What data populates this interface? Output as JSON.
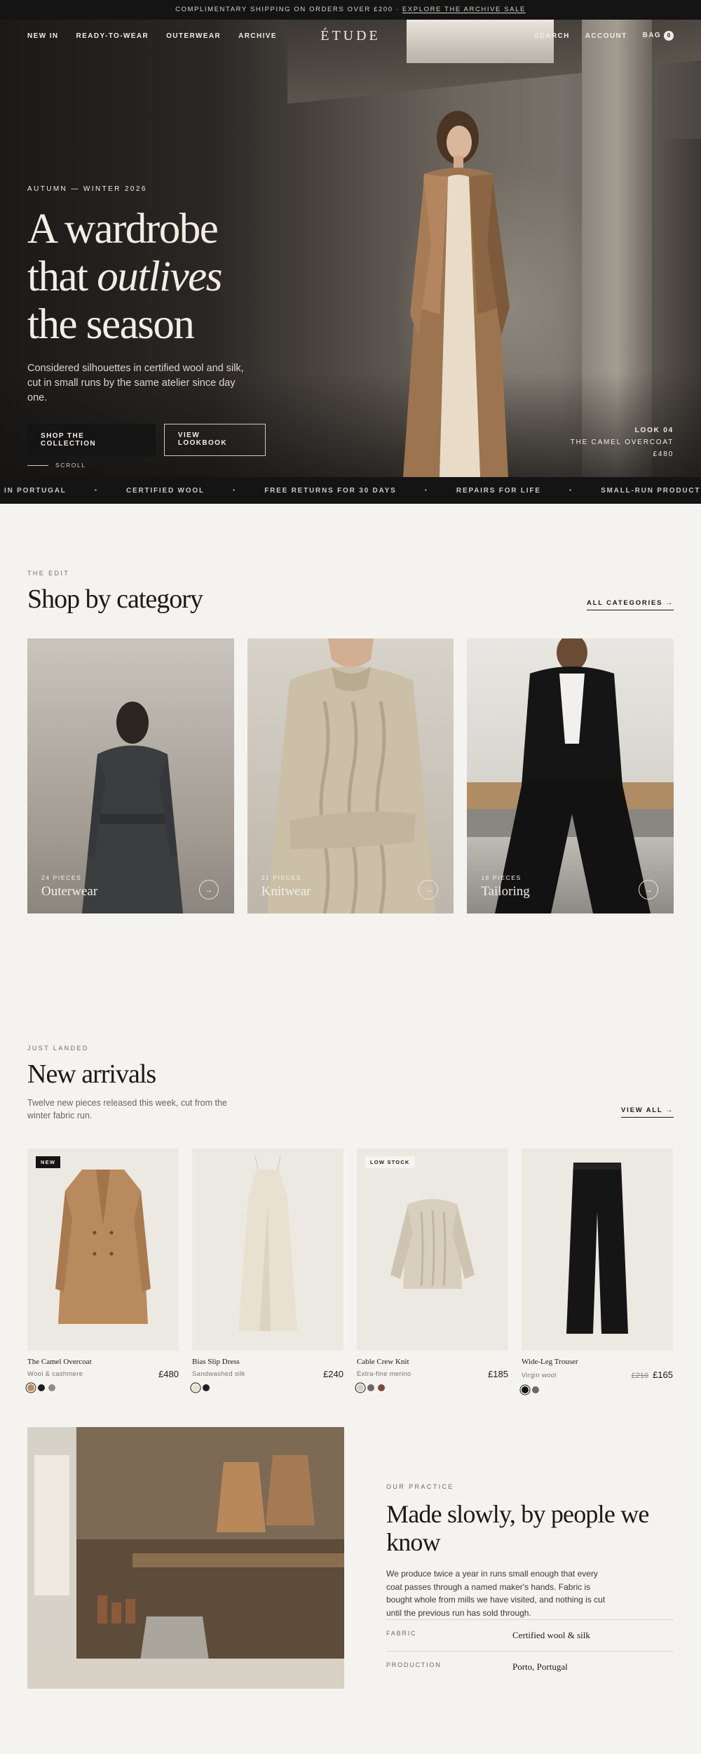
{
  "topbar": {
    "text": "COMPLIMENTARY SHIPPING ON ORDERS OVER £200 · ",
    "link": "EXPLORE THE ARCHIVE SALE"
  },
  "nav": {
    "left": [
      "NEW IN",
      "READY-TO-WEAR",
      "OUTERWEAR",
      "ARCHIVE"
    ],
    "logo": "ÉTUDE",
    "search": "SEARCH",
    "account": "ACCOUNT",
    "bag": "BAG",
    "bag_count": "0"
  },
  "hero": {
    "eyebrow": "AUTUMN — WINTER 2026",
    "title_l1": "A wardrobe",
    "title_l2a": "that ",
    "title_l2b": "outlives",
    "title_l3": "the season",
    "desc": "Considered silhouettes in certified wool and silk, cut in small runs by the same atelier since day one.",
    "btn_primary": "SHOP THE COLLECTION",
    "btn_secondary": "VIEW LOOKBOOK",
    "scroll": "SCROLL",
    "look_no": "LOOK 04",
    "look_name": "THE CAMEL OVERCOAT",
    "look_price": "£480"
  },
  "ticker": [
    "IN PORTUGAL",
    "CERTIFIED WOOL",
    "FREE RETURNS FOR 30 DAYS",
    "REPAIRS FOR LIFE",
    "SMALL-RUN PRODUCTION"
  ],
  "categories": {
    "eyebrow": "THE EDIT",
    "title": "Shop by category",
    "link": "ALL CATEGORIES →",
    "items": [
      {
        "count": "24 PIECES",
        "name": "Outerwear"
      },
      {
        "count": "31 PIECES",
        "name": "Knitwear"
      },
      {
        "count": "18 PIECES",
        "name": "Tailoring"
      }
    ]
  },
  "arrivals": {
    "eyebrow": "JUST LANDED",
    "title": "New arrivals",
    "sub": "Twelve new pieces released this week, cut from the winter fabric run.",
    "link": "VIEW ALL →",
    "products": [
      {
        "tag": "NEW",
        "name": "The Camel Overcoat",
        "material": "Wool & cashmere",
        "price": "£480",
        "old_price": "",
        "swatches": [
          "#b98a5e",
          "#1f1f1f",
          "#8f8c86"
        ]
      },
      {
        "tag": "",
        "name": "Bias Slip Dress",
        "material": "Sandwashed silk",
        "price": "£240",
        "old_price": "",
        "swatches": [
          "#e8e0cf",
          "#1f1f1f"
        ]
      },
      {
        "tag": "LOW STOCK",
        "name": "Cable Crew Knit",
        "material": "Extra-fine merino",
        "price": "£185",
        "old_price": "",
        "swatches": [
          "#d9cfbe",
          "#6d6a64",
          "#7a4a35"
        ]
      },
      {
        "tag": "",
        "name": "Wide-Leg Trouser",
        "material": "Virgin wool",
        "price": "£165",
        "old_price": "£210",
        "swatches": [
          "#141414",
          "#6d6a64"
        ]
      }
    ]
  },
  "practice": {
    "eyebrow": "OUR PRACTICE",
    "title": "Made slowly, by people we know",
    "body": "We produce twice a year in runs small enough that every coat passes through a named maker's hands. Fabric is bought whole from mills we have visited, and nothing is cut until the previous run has sold through.",
    "specs": [
      {
        "label": "FABRIC",
        "value": "Certified wool & silk"
      },
      {
        "label": "PRODUCTION",
        "value": "Porto, Portugal"
      }
    ]
  }
}
